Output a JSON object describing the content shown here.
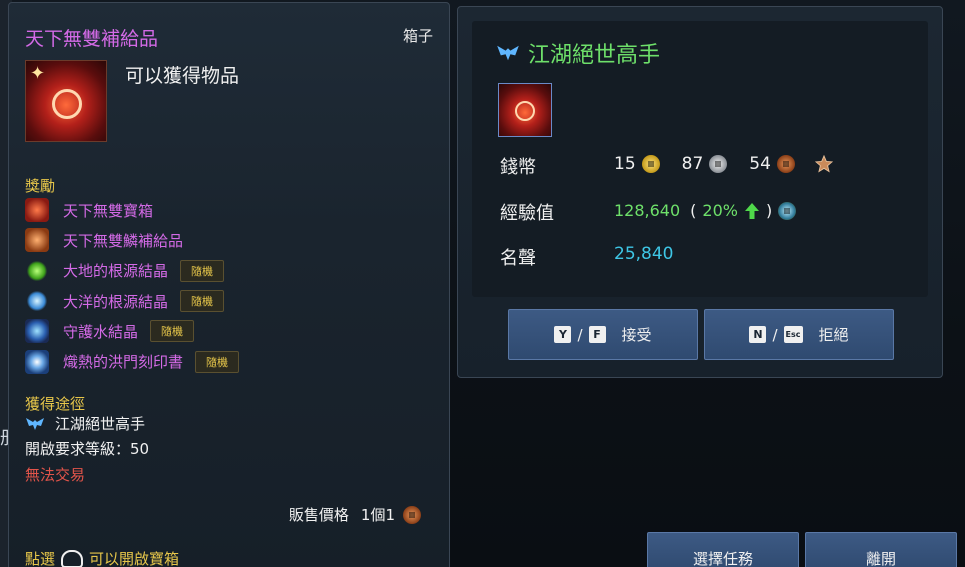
{
  "tooltip": {
    "title": "天下無雙補給品",
    "type": "箱子",
    "description": "可以獲得物品",
    "reward_header": "獎勵",
    "rewards": [
      {
        "label": "天下無雙寶箱",
        "badge": ""
      },
      {
        "label": "天下無雙鱗補給品",
        "badge": ""
      },
      {
        "label": "大地的根源結晶",
        "badge": "隨機"
      },
      {
        "label": "大洋的根源結晶",
        "badge": "隨機"
      },
      {
        "label": "守護水結晶",
        "badge": "隨機"
      },
      {
        "label": "熾熱的洪門刻印書",
        "badge": "隨機"
      }
    ],
    "source_header": "獲得途徑",
    "source": "江湖絕世高手",
    "level_requirement": "開啟要求等級：50",
    "trade": "無法交易",
    "price_label": "販售價格",
    "price_value": "1個1",
    "hint_prefix": "點選",
    "hint_suffix": "可以開啟寶箱"
  },
  "quest": {
    "title": "江湖絕世高手",
    "money_label": "錢幣",
    "gold": "15",
    "silver": "87",
    "copper": "54",
    "exp_label": "經驗值",
    "exp_value": "128,640",
    "exp_open": "(",
    "exp_percent": "20%",
    "exp_close": ")",
    "fame_label": "名聲",
    "fame_value": "25,840",
    "accept": {
      "key1": "Y",
      "key2": "F",
      "label": "接受"
    },
    "reject": {
      "key1": "N",
      "key2": "Esc",
      "label": "拒絕"
    }
  },
  "bottom_buttons": {
    "select_quest": "選擇任務",
    "leave": "離開"
  },
  "background": {
    "glyph": "册"
  },
  "colors": {
    "item_name": "#d36ae6",
    "section_header": "#e6c64a",
    "quest_title": "#6ee06a",
    "fame": "#3ec6e6",
    "untradable": "#e2544a",
    "button": "#3d5a84"
  }
}
